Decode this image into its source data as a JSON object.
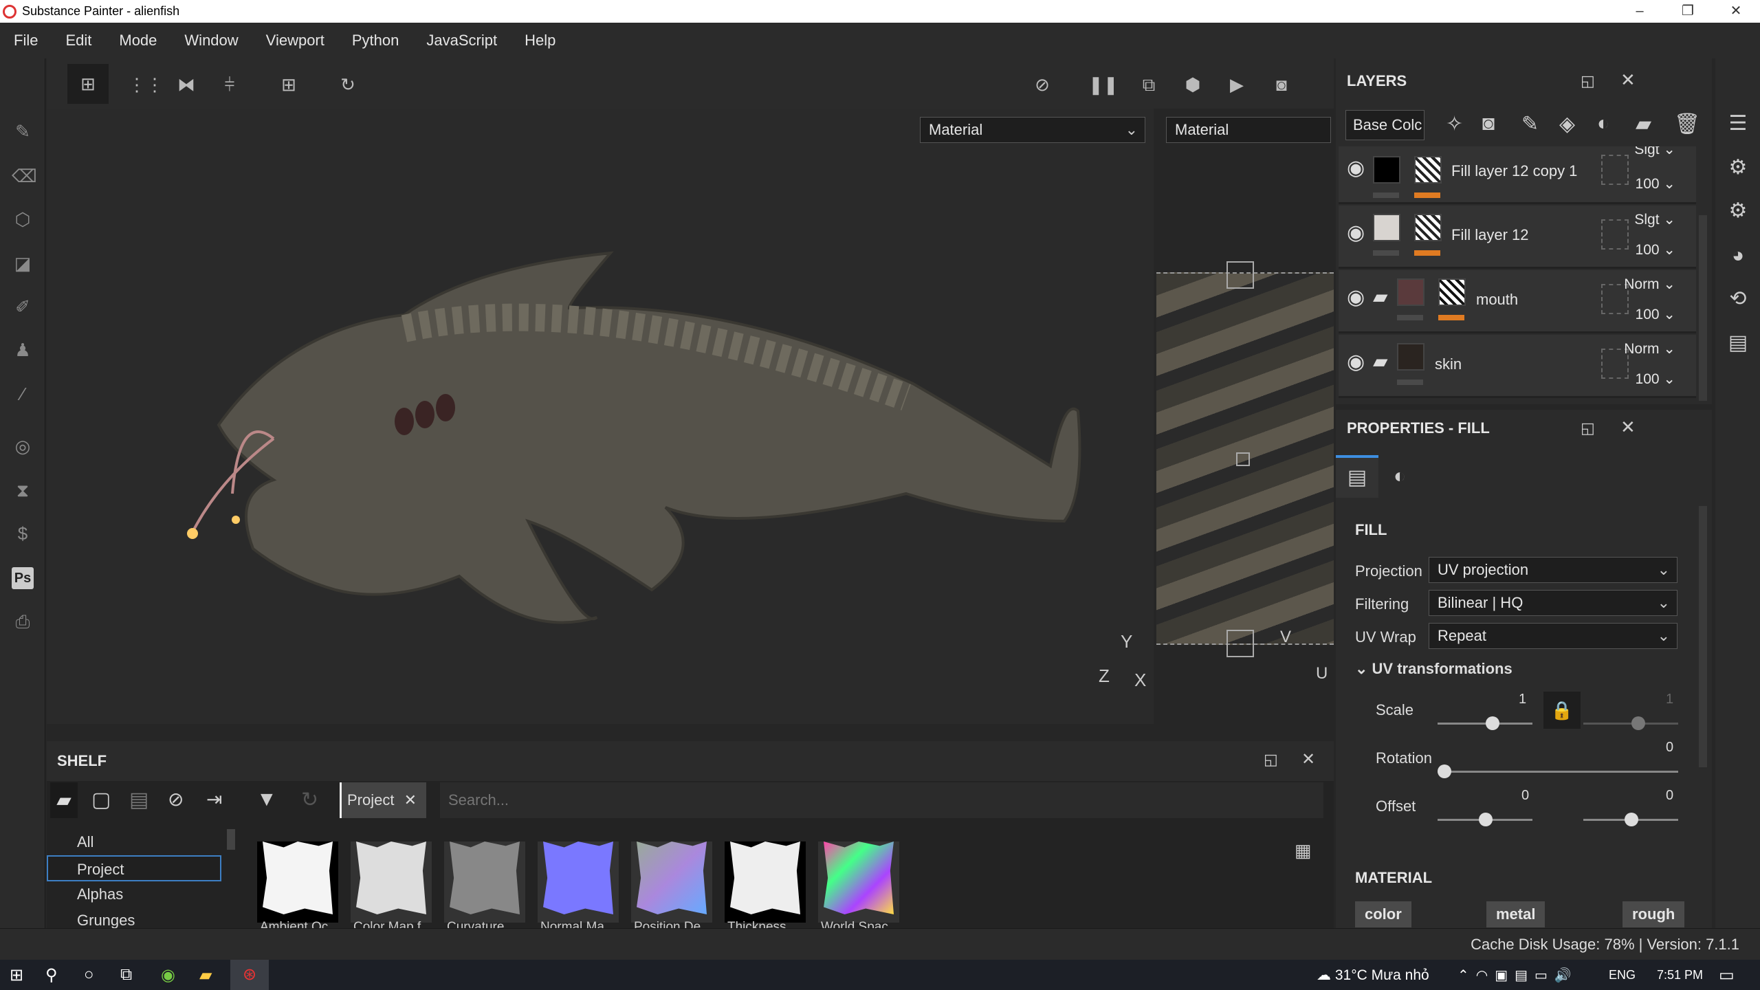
{
  "window": {
    "title": "Substance Painter - alienfish",
    "min": "–",
    "max": "❐",
    "close": "✕"
  },
  "menu": [
    "File",
    "Edit",
    "Mode",
    "Window",
    "Viewport",
    "Python",
    "JavaScript",
    "Help"
  ],
  "viewport": {
    "mode_left": "Material",
    "mode_right": "Material",
    "axis": {
      "y": "Y",
      "z": "Z",
      "x": "X",
      "v": "V",
      "u": "U"
    }
  },
  "layers": {
    "title": "LAYERS",
    "channel": "Base Colc",
    "items": [
      {
        "name": "Fill layer 12 copy 1",
        "blend": "Slgt",
        "opacity": "100"
      },
      {
        "name": "Fill layer 12",
        "blend": "Slgt",
        "opacity": "100"
      },
      {
        "name": "mouth",
        "blend": "Norm",
        "opacity": "100"
      },
      {
        "name": "skin",
        "blend": "Norm",
        "opacity": "100"
      }
    ]
  },
  "properties": {
    "title": "PROPERTIES - FILL",
    "section": "FILL",
    "projection_label": "Projection",
    "projection": "UV projection",
    "filtering_label": "Filtering",
    "filtering": "Bilinear | HQ",
    "uvwrap_label": "UV Wrap",
    "uvwrap": "Repeat",
    "uvt_label": "UV transformations",
    "scale_label": "Scale",
    "scale_u": "1",
    "scale_v": "1",
    "rotation_label": "Rotation",
    "rotation": "0",
    "offset_label": "Offset",
    "offset_u": "0",
    "offset_v": "0",
    "material_label": "MATERIAL",
    "mat_buttons": [
      "color",
      "metal",
      "rough"
    ]
  },
  "shelf": {
    "title": "SHELF",
    "filter_tag": "Project",
    "search_placeholder": "Search...",
    "categories": [
      "All",
      "Project",
      "Alphas",
      "Grunges"
    ],
    "items": [
      "Ambient Oc",
      "Color Map f",
      "Curvature",
      "Normal Ma",
      "Position De",
      "Thickness",
      "World Spac"
    ]
  },
  "status": "Cache Disk Usage: 78% | Version: 7.1.1",
  "taskbar": {
    "weather": "31°C  Mưa nhỏ",
    "lang": "ENG",
    "time": "7:51 PM"
  }
}
